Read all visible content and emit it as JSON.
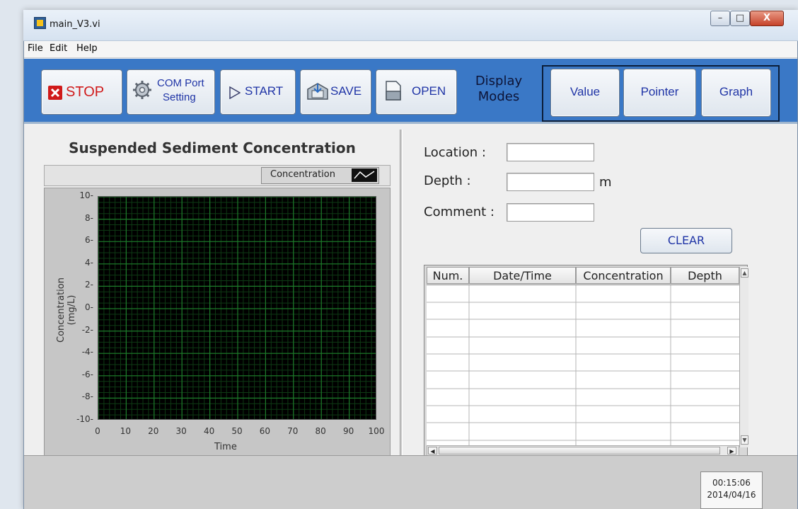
{
  "window": {
    "title": "main_V3.vi",
    "controls": {
      "minimize": "–",
      "maximize": "□",
      "close": "X"
    }
  },
  "menu": {
    "items": [
      "File",
      "Edit",
      "Help"
    ]
  },
  "toolbar": {
    "stop_label": "STOP",
    "com_line1": "COM Port",
    "com_line2": "Setting",
    "start_label": "START",
    "save_label": "SAVE",
    "open_label": "OPEN",
    "display_modes_line1": "Display",
    "display_modes_line2": "Modes",
    "mode_value": "Value",
    "mode_pointer": "Pointer",
    "mode_graph": "Graph"
  },
  "chart_data": {
    "type": "line",
    "title": "Suspended Sediment Concentration",
    "xlabel": "Time",
    "ylabel": "Concentration (mg/L)",
    "xlim": [
      0,
      100
    ],
    "ylim": [
      -10,
      10
    ],
    "x_ticks": [
      "0",
      "10",
      "20",
      "30",
      "40",
      "50",
      "60",
      "70",
      "80",
      "90",
      "100"
    ],
    "y_ticks": [
      "10",
      "8",
      "6",
      "4",
      "2",
      "0",
      "-2",
      "-4",
      "-6",
      "-8",
      "-10"
    ],
    "grid": true,
    "legend_placement": "top-right",
    "series": [
      {
        "name": "Concentration",
        "values": []
      }
    ],
    "colors": {
      "plot_bg": "#000000",
      "major_grid": "#1d7a2a",
      "minor_grid": "#0e3a14"
    }
  },
  "form": {
    "location_label": "Location :",
    "location_value": "",
    "depth_label": "Depth :",
    "depth_value": "",
    "depth_unit": "m",
    "comment_label": "Comment :",
    "comment_value": "",
    "clear_label": "CLEAR"
  },
  "table": {
    "columns": [
      "Num.",
      "Date/Time",
      "Concentration",
      "Depth"
    ],
    "rows": []
  },
  "status": {
    "time": "00:15:06",
    "date": "2014/04/16"
  },
  "colors": {
    "toolbar_bg": "#3a78c6",
    "accent_text": "#1f34a6",
    "stop_red": "#d01a1a"
  }
}
